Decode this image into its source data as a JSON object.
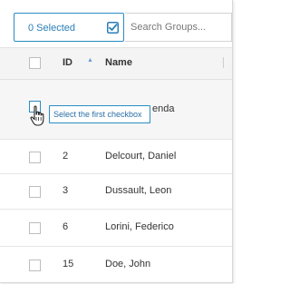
{
  "toolbar": {
    "selected_label": "0 Selected",
    "search_placeholder": "Search Groups..."
  },
  "table": {
    "columns": {
      "id": "ID",
      "name": "Name"
    },
    "rows": [
      {
        "id": "",
        "name": "enda"
      },
      {
        "id": "2",
        "name": "Delcourt, Daniel"
      },
      {
        "id": "3",
        "name": "Dussault, Leon"
      },
      {
        "id": "6",
        "name": "Lorini, Federico"
      },
      {
        "id": "15",
        "name": "Doe, John"
      }
    ]
  },
  "tooltip": {
    "text": "Select the first checkbox"
  },
  "colors": {
    "accent": "#2a8dc3",
    "header_bg": "#f4f4f4",
    "border": "#e3e3e3"
  },
  "icons": {
    "select_all": "checkbox-checked-icon",
    "sort": "sort-ascending-icon",
    "cursor": "hand-pointer-icon"
  }
}
